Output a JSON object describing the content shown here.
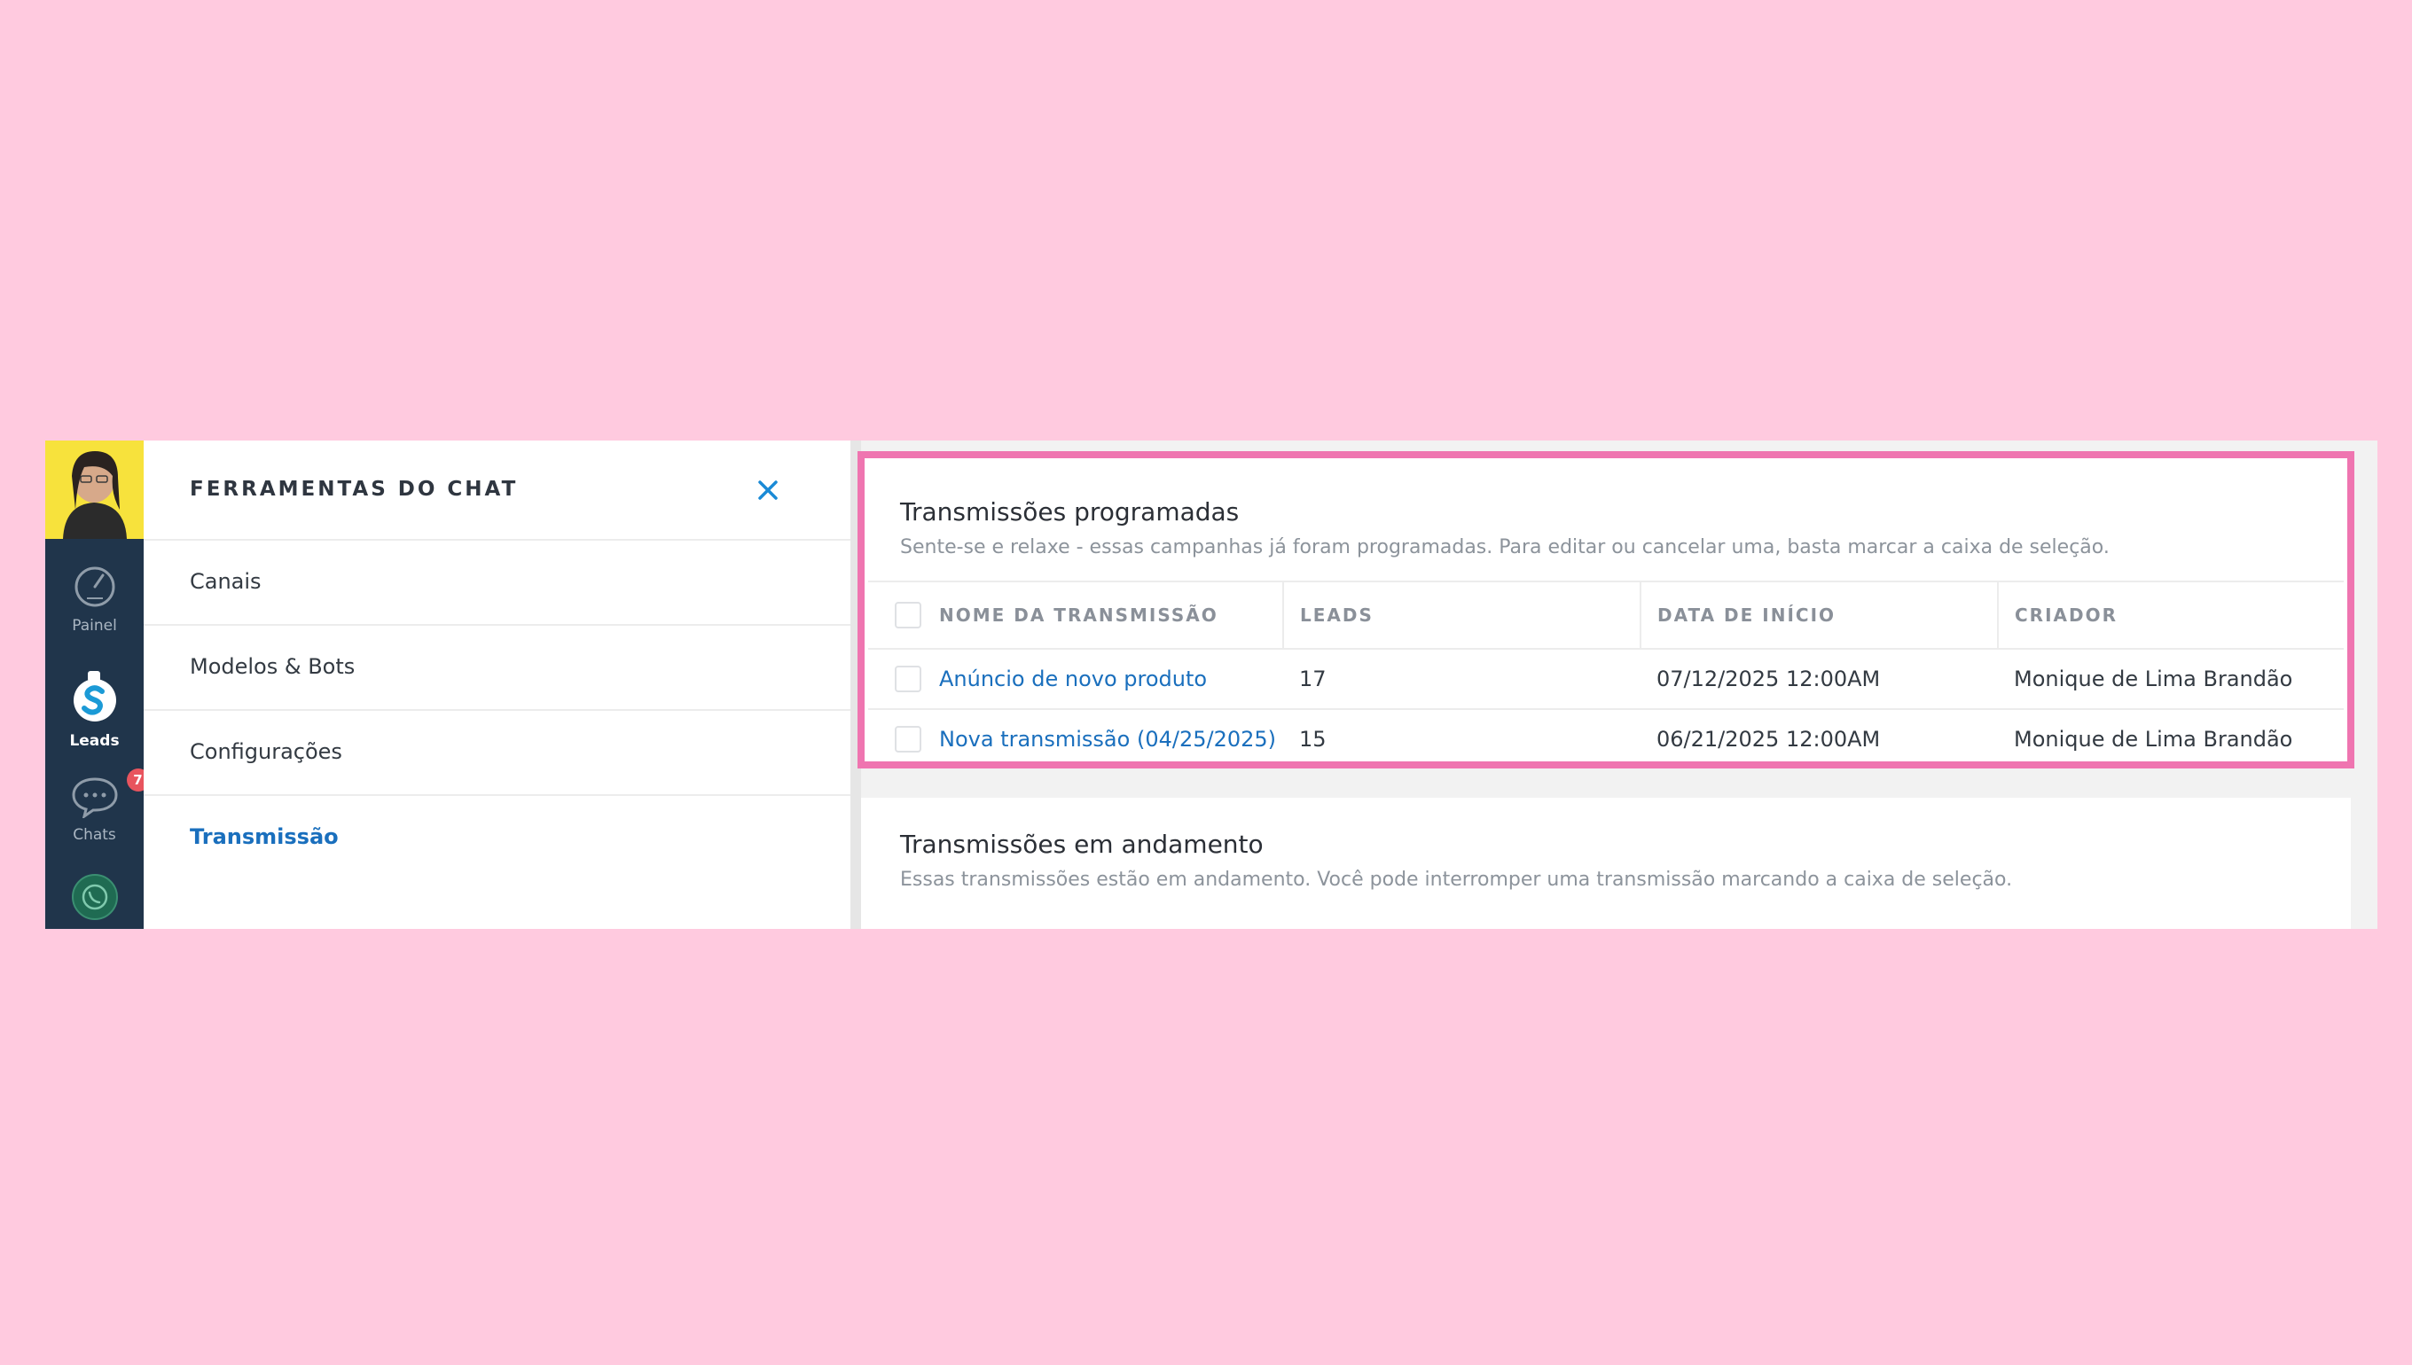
{
  "sidebar": {
    "items": [
      {
        "label": "Painel",
        "icon": "speedometer-icon"
      },
      {
        "label": "Leads",
        "icon": "leads-logo-icon"
      },
      {
        "label": "Chats",
        "icon": "chat-bubble-icon",
        "badge": "7"
      },
      {
        "label": "",
        "icon": "whatsapp-icon"
      }
    ]
  },
  "tools": {
    "title": "FERRAMENTAS DO CHAT",
    "menu": [
      "Canais",
      "Modelos & Bots",
      "Configurações",
      "Transmissão"
    ]
  },
  "scheduled": {
    "title": "Transmissões programadas",
    "subtitle": "Sente-se e relaxe - essas campanhas já foram programadas. Para editar ou cancelar uma, basta marcar a caixa de seleção.",
    "columns": [
      "NOME DA TRANSMISSÃO",
      "LEADS",
      "DATA DE INÍCIO",
      "CRIADOR"
    ],
    "rows": [
      {
        "name": "Anúncio de novo produto",
        "leads": "17",
        "start": "07/12/2025 12:00AM",
        "creator": "Monique de Lima Brandão"
      },
      {
        "name": "Nova transmissão (04/25/2025)",
        "leads": "15",
        "start": "06/21/2025 12:00AM",
        "creator": "Monique de Lima Brandão"
      }
    ]
  },
  "ongoing": {
    "title": "Transmissões em andamento",
    "subtitle": "Essas transmissões estão em andamento. Você pode interromper uma transmissão marcando a caixa de seleção."
  },
  "colors": {
    "accent": "#1a6fbd",
    "highlight": "#ef75b0",
    "sidebar": "#20354b",
    "background": "#ffcadf"
  }
}
